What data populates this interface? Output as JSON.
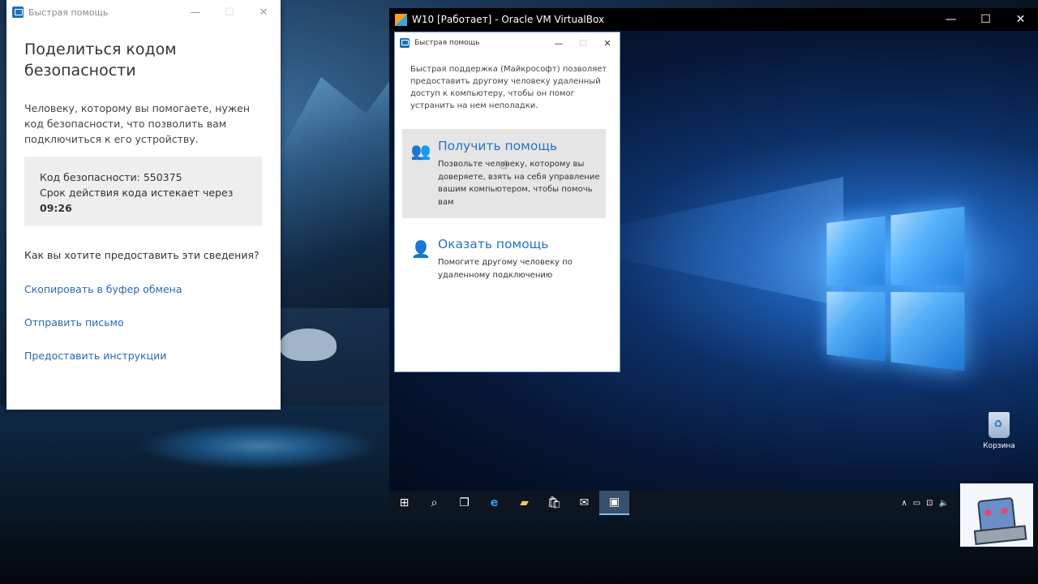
{
  "host_window": {
    "title": "Быстрая помощь",
    "heading": "Поделиться кодом безопасности",
    "description": "Человеку, которому вы помогаете, нужен код безопасности, что позволить вам подключиться к его устройству.",
    "code_label": "Код безопасности: 550375",
    "expiry_label": "Срок действия кода истекает через",
    "expiry_time": "09:26",
    "question": "Как вы хотите предоставить эти сведения?",
    "links": [
      "Скопировать в буфер обмена",
      "Отправить письмо",
      "Предоставить инструкции"
    ]
  },
  "vbox": {
    "title": "W10 [Работает] - Oracle VM VirtualBox"
  },
  "guest_window": {
    "title": "Быстрая помощь",
    "description": "Быстрая поддержка (Майкрософт) позволяет предоставить другому человеку удаленный доступ к компьютеру, чтобы он помог устранить на нем неполадки.",
    "options": [
      {
        "title": "Получить помощь",
        "description": "Позвольте человеку, которому вы доверяете, взять на себя управление вашим компьютером, чтобы помочь вам",
        "icon": "get-help-icon"
      },
      {
        "title": "Оказать помощь",
        "description": "Помогите другому человеку по удаленному подключению",
        "icon": "give-help-icon"
      }
    ]
  },
  "guest_desktop": {
    "recycle_bin_label": "Корзина"
  },
  "taskbar": {
    "items": [
      "start-icon",
      "search-icon",
      "task-view-icon",
      "edge-icon",
      "explorer-icon",
      "store-icon",
      "mail-icon",
      "quick-assist-icon"
    ]
  }
}
